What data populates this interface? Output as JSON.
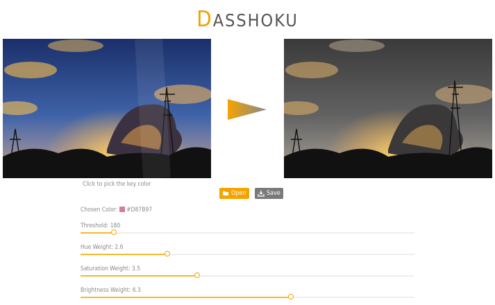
{
  "logo": {
    "first_letter": "D",
    "rest": "ASSHOKU"
  },
  "images": {
    "source_name": "source-photo",
    "output_name": "desaturated-photo"
  },
  "hint": "Click to pick the key color",
  "buttons": {
    "open_label": "Open",
    "save_label": "Save"
  },
  "chosen_color": {
    "label": "Chosen Color:",
    "hex": "#D87B97",
    "swatch_color": "#d87b97"
  },
  "sliders": [
    {
      "label": "Threshold: 180",
      "value_fraction": 0.1
    },
    {
      "label": "Hue Weight: 2.6",
      "value_fraction": 0.26
    },
    {
      "label": "Saturation Weight: 3.5",
      "value_fraction": 0.35
    },
    {
      "label": "Brightness Weight: 6.3",
      "value_fraction": 0.63
    }
  ],
  "colors": {
    "accent": "#f5a300",
    "save_button": "#7a7a7a"
  }
}
